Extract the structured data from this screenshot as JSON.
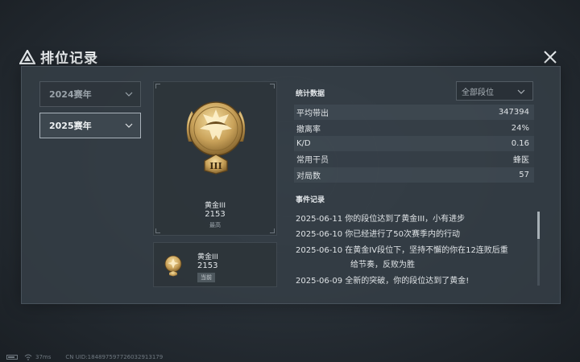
{
  "header": {
    "title": "排位记录"
  },
  "seasons": [
    {
      "label": "2024赛年",
      "active": false
    },
    {
      "label": "2025赛年",
      "active": true
    }
  ],
  "rank_card": {
    "name": "黄金III",
    "score": "2153",
    "tag": "最高",
    "numeral": "III"
  },
  "current_card": {
    "name": "黄金III",
    "score": "2153",
    "tag": "当前"
  },
  "stats": {
    "title": "统计数据",
    "filter": "全部段位",
    "rows": [
      {
        "label": "平均带出",
        "value": "347394"
      },
      {
        "label": "撤离率",
        "value": "24%"
      },
      {
        "label": "K/D",
        "value": "0.16"
      },
      {
        "label": "常用干员",
        "value": "蜂医"
      },
      {
        "label": "对局数",
        "value": "57"
      }
    ]
  },
  "events": {
    "title": "事件记录",
    "rows": [
      {
        "text": "2025-06-11 你的段位达到了黄金III，小有进步"
      },
      {
        "text": "2025-06-10 你已经进行了50次赛季内的行动"
      },
      {
        "text": "2025-06-10 在黄金IV段位下，坚持不懈的你在12连败后重"
      },
      {
        "text": "给节奏，反败为胜"
      },
      {
        "text": "2025-06-09 全新的突破，你的段位达到了黄金!"
      }
    ]
  },
  "footer": {
    "ping": "37ms",
    "uid": "CN UID:184897597726032913179"
  },
  "colors": {
    "gold": "#c9a25a",
    "panel": "#343d45",
    "text": "#d6dbe0"
  }
}
